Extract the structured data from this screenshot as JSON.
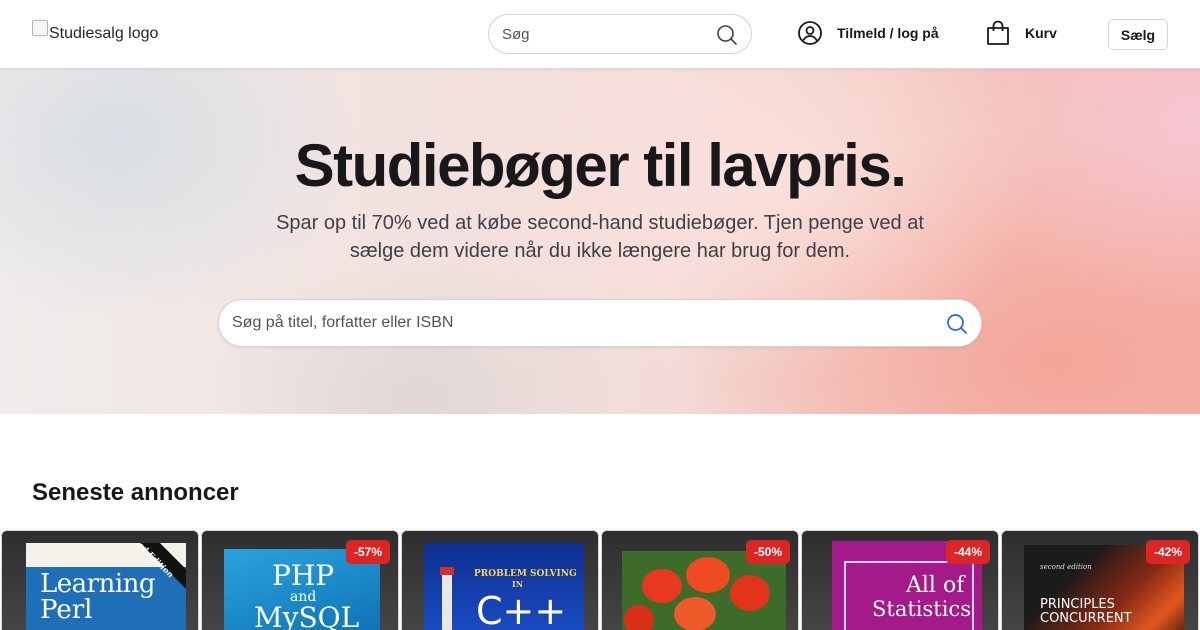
{
  "header": {
    "logo_alt": "Studiesalg logo",
    "search_placeholder": "Søg",
    "login_label": "Tilmeld / log på",
    "cart_label": "Kurv",
    "sell_label": "Sælg"
  },
  "hero": {
    "title": "Studiebøger til lavpris.",
    "subtitle": "Spar op til 70% ved at købe second-hand studiebøger. Tjen penge ved at sælge dem videre når du ikke længere har brug for dem.",
    "search_placeholder": "Søg på titel, forfatter eller ISBN"
  },
  "listings": {
    "title": "Seneste annoncer",
    "items": [
      {
        "book_title_1": "Learning",
        "book_title_2": "Perl",
        "edition": "3rd Edition",
        "discount": ""
      },
      {
        "book_title_1": "PHP",
        "book_title_2": "MySQL",
        "book_title_and": "and",
        "discount": "-57%"
      },
      {
        "book_title_1": "PROBLEM SOLVING",
        "book_title_in": "IN",
        "book_title_2": "C++",
        "discount": ""
      },
      {
        "discount": "-50%"
      },
      {
        "book_title_1": "All of",
        "book_title_2": "Statistics",
        "discount": "-44%"
      },
      {
        "book_title_1": "PRINCIPLES",
        "book_title_2": "CONCURRENT",
        "edition": "second edition",
        "discount": "-42%"
      }
    ]
  },
  "colors": {
    "badge": "#dc2626",
    "link_icon": "#2563eb"
  }
}
